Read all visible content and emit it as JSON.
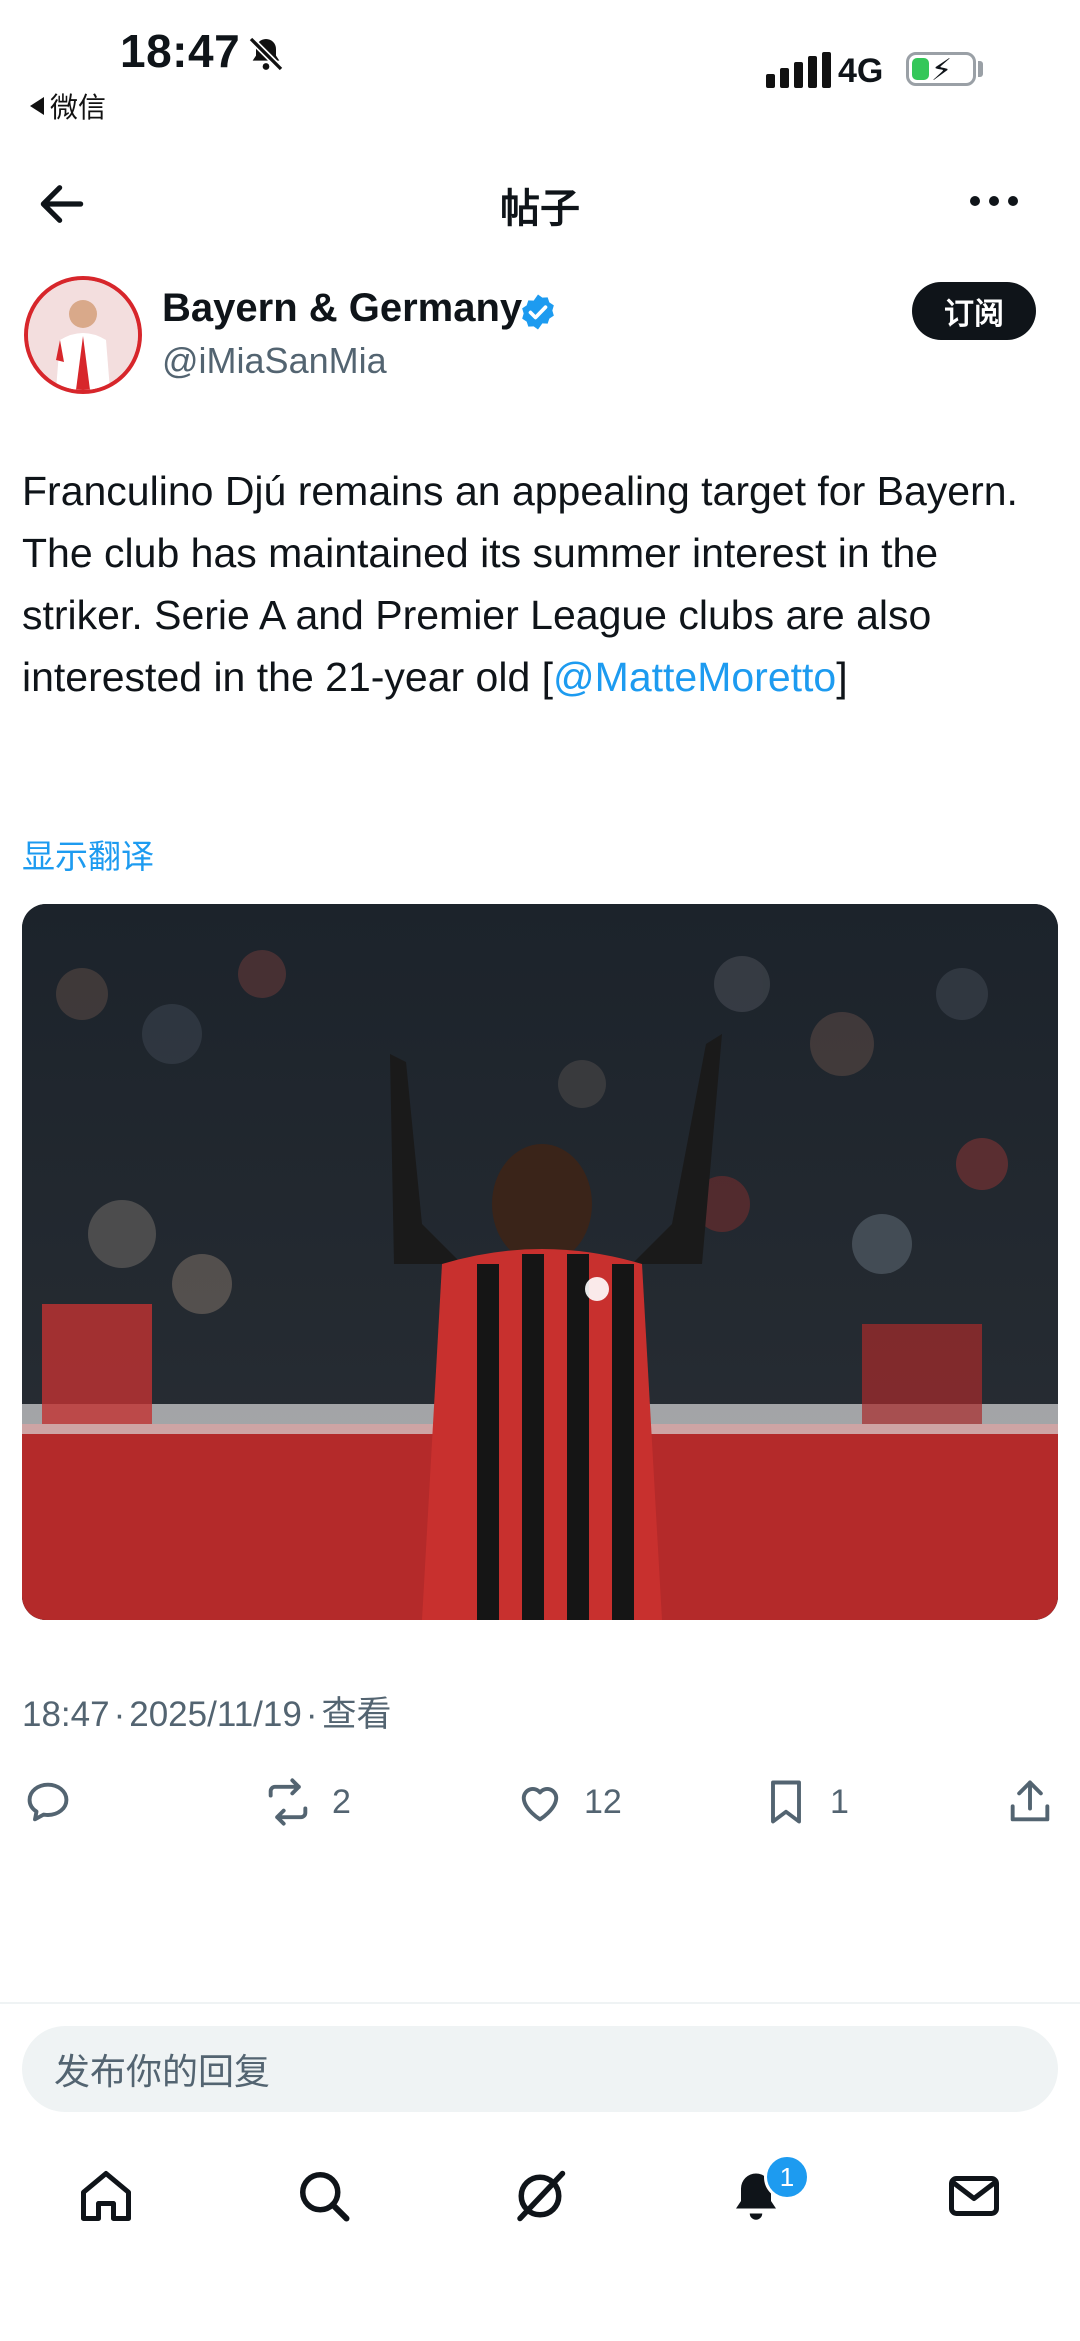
{
  "status_bar": {
    "time": "18:47",
    "back_app": "微信",
    "network": "4G",
    "battery_level": 0.3
  },
  "header": {
    "title": "帖子"
  },
  "author": {
    "name": "Bayern & Germany",
    "handle": "@iMiaSanMia",
    "verified": true,
    "subscribe_label": "订阅"
  },
  "post": {
    "text_before": "Franculino Djú remains an appealing target for Bayern. The club has maintained its summer interest in the striker. Serie A and Premier League clubs are also interested in the 21-year old [",
    "mention": "@MatteMoretto",
    "text_after": "]",
    "translate_label": "显示翻译",
    "media_icon": "photo-of-footballer",
    "time": "18:47",
    "date": "2025/11/19",
    "views_label": "查看"
  },
  "actions": {
    "reply_count": "",
    "repost_count": "2",
    "like_count": "12",
    "bookmark_count": "1"
  },
  "reply_bar": {
    "placeholder": "发布你的回复"
  },
  "bottom_nav": {
    "items": [
      "home-icon",
      "search-icon",
      "grok-icon",
      "notifications-icon",
      "messages-icon"
    ],
    "notification_badge": "1"
  },
  "colors": {
    "accent": "#1d9bf0",
    "text": "#0f1419",
    "secondary": "#536471"
  }
}
